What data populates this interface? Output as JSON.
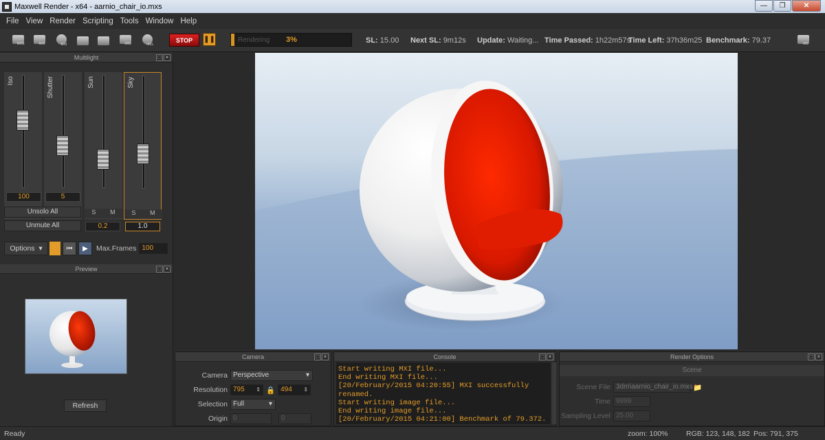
{
  "window": {
    "title": "Maxwell Render  -  x64 - aarnio_chair_io.mxs"
  },
  "menu": [
    "File",
    "View",
    "Render",
    "Scripting",
    "Tools",
    "Window",
    "Help"
  ],
  "toolbar": {
    "buttons": [
      {
        "name": "mxs",
        "label": "MXS"
      },
      {
        "name": "mxi",
        "label": "MXI"
      },
      {
        "name": "mxi-sphere",
        "label": "MXI"
      },
      {
        "name": "film-strip",
        "label": ""
      },
      {
        "name": "refresh-scene",
        "label": ""
      },
      {
        "name": "img",
        "label": "IMG"
      },
      {
        "name": "img-sphere",
        "label": "IMG"
      }
    ],
    "stop_label": "STOP",
    "progress_text": "Rendering",
    "progress_pct": "3%",
    "progress_fraction": 0.03,
    "right_button_label": "MS"
  },
  "stats": {
    "sl_label": "SL:",
    "sl_value": "15.00",
    "next_sl_label": "Next SL:",
    "next_sl_value": "9m12s",
    "update_label": "Update:",
    "update_value": "Waiting...",
    "time_passed_label": "Time Passed:",
    "time_passed_value": "1h22m57s",
    "time_left_label": "Time Left:",
    "time_left_value": "37h36m25",
    "benchmark_label": "Benchmark:",
    "benchmark_value": "79.37"
  },
  "multilight": {
    "title": "Multilight",
    "channels": [
      {
        "name": "Iso",
        "value": "100",
        "level": 0.62
      },
      {
        "name": "Shutter",
        "value": "5",
        "level": 0.35
      },
      {
        "name": "Sun",
        "value": "0.2",
        "level": 0.2
      },
      {
        "name": "Sky",
        "value": "1.0",
        "level": 0.27
      }
    ],
    "s_label": "S",
    "m_label": "M",
    "unsolo_label": "Unsolo All",
    "unmute_label": "Unmute All",
    "options_label": "Options",
    "max_frames_label": "Max.Frames",
    "max_frames_value": "100"
  },
  "preview": {
    "title": "Preview",
    "refresh_label": "Refresh"
  },
  "camera_panel": {
    "title": "Camera",
    "camera_label": "Camera",
    "camera_value": "Perspective",
    "resolution_label": "Resolution",
    "res_w": "795",
    "res_h": "494",
    "selection_label": "Selection",
    "selection_value": "Full",
    "origin_label": "Origin",
    "origin_x": "0",
    "origin_y": "0"
  },
  "console": {
    "title": "Console",
    "lines": "Start writing MXI file...\nEnd writing MXI file...\n[20/February/2015 04:20:55] MXI successfully\nrenamed.\nStart writing image file...\nEnd writing image file...\n[20/February/2015 04:21:00] Benchmark of 79.372."
  },
  "render_options": {
    "title": "Render Options",
    "tab": "Scene",
    "scene_file_label": "Scene File",
    "scene_file_value": "3dm\\aarnio_chair_io.mxs",
    "time_label": "Time",
    "time_value": "9999",
    "sampling_label": "Sampling Level",
    "sampling_value": "25.00"
  },
  "status": {
    "ready": "Ready",
    "zoom": "zoom: 100%",
    "rgb": "RGB: 123, 148, 182",
    "pos": "Pos: 791, 375"
  }
}
